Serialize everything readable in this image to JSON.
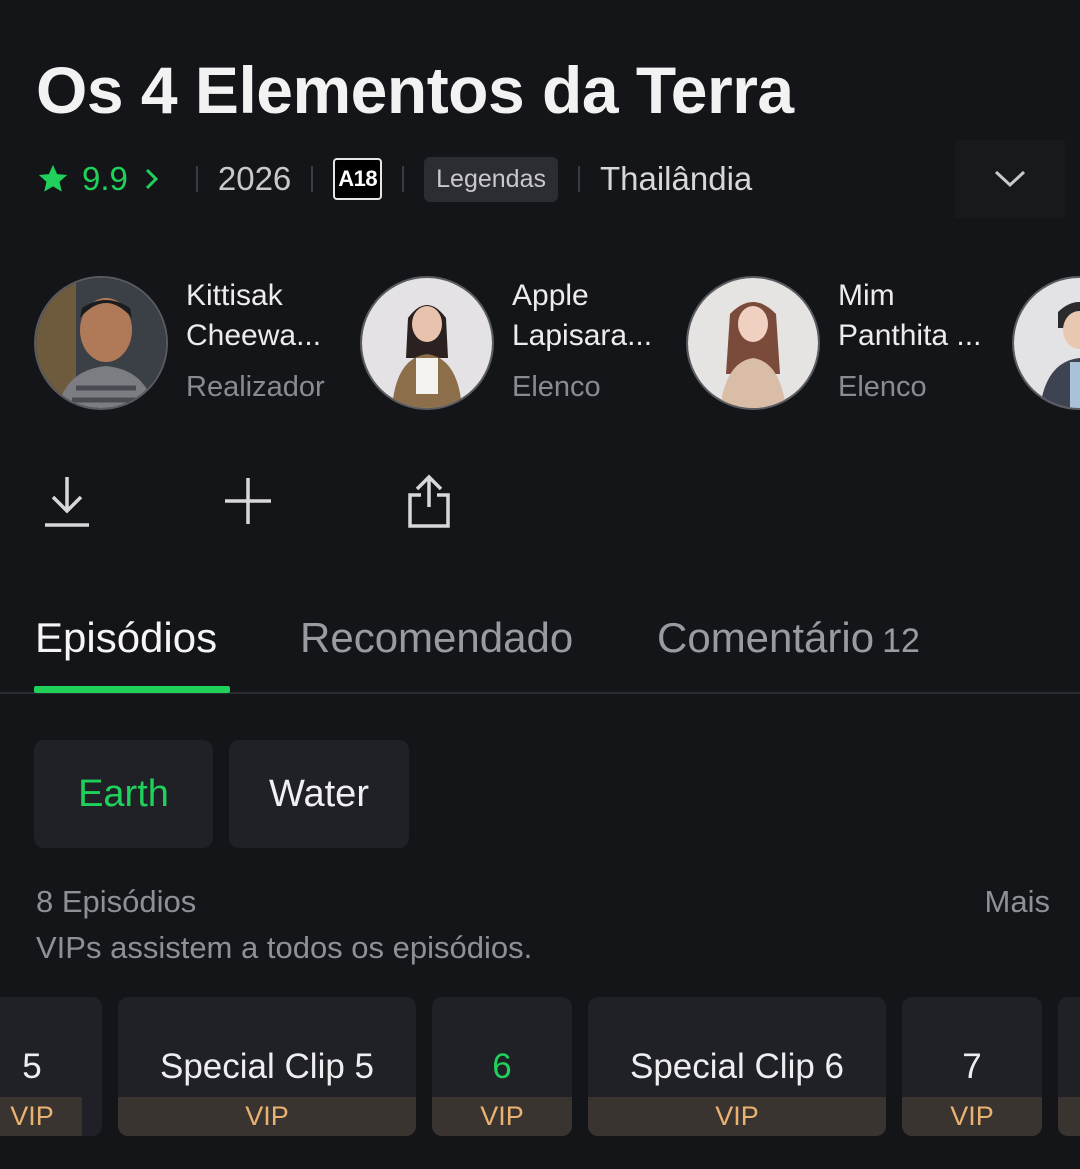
{
  "title": "Os 4 Elementos da Terra",
  "meta": {
    "rating": "9.9",
    "year": "2026",
    "age_rating": "A18",
    "subtitles": "Legendas",
    "country": "Thailândia"
  },
  "cast": [
    {
      "name": "Kittisak Cheewa...",
      "role": "Realizador"
    },
    {
      "name": "Apple Lapisara...",
      "role": "Elenco"
    },
    {
      "name": "Mim Panthita ...",
      "role": "Elenco"
    },
    {
      "name": "",
      "role": ""
    }
  ],
  "tabs": {
    "episodes": "Episódios",
    "recommended": "Recomendado",
    "comments": "Comentário",
    "comments_count": "12"
  },
  "seasons": [
    "Earth",
    "Water"
  ],
  "episode_info": {
    "count": "8 Episódios",
    "more": "Mais",
    "vip_note": "VIPs assistem a todos os episódios."
  },
  "episodes": [
    {
      "label": "5",
      "badge": "VIP"
    },
    {
      "label": "Special Clip 5",
      "badge": "VIP"
    },
    {
      "label": "6",
      "badge": "VIP"
    },
    {
      "label": "Special Clip 6",
      "badge": "VIP"
    },
    {
      "label": "7",
      "badge": "VIP"
    }
  ],
  "colors": {
    "accent": "#1fd15a",
    "background": "#141519",
    "vip_text": "#e9b271"
  }
}
